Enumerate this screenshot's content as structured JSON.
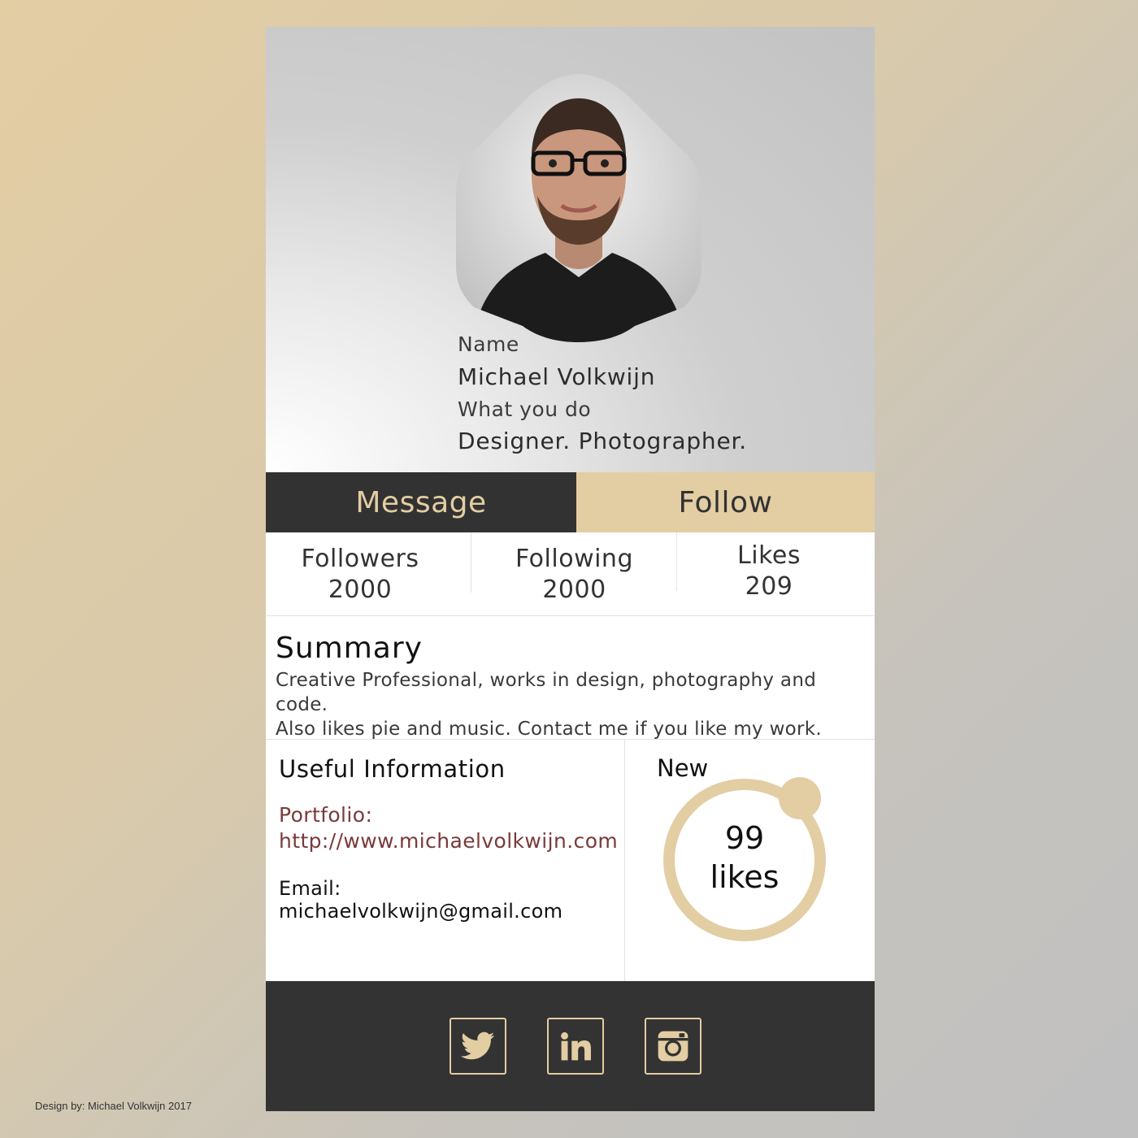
{
  "profile": {
    "name_label": "Name",
    "name": "Michael Volkwijn",
    "role_label": "What you do",
    "role": "Designer. Photographer."
  },
  "actions": {
    "message_label": "Message",
    "follow_label": "Follow"
  },
  "stats": [
    {
      "label": "Followers",
      "value": "2000"
    },
    {
      "label": "Following",
      "value": "2000"
    },
    {
      "label": "Likes",
      "value": "209"
    }
  ],
  "summary": {
    "title": "Summary",
    "line1": "Creative Professional, works in design, photography and code.",
    "line2": "Also likes pie and music. Contact me if you like my work."
  },
  "info": {
    "title": "Useful Information",
    "portfolio_label": "Portfolio:",
    "portfolio_url": "http://www.michaelvolkwijn.com",
    "email": "Email: michaelvolkwijn@gmail.com"
  },
  "new_likes": {
    "label": "New",
    "count": "99",
    "unit": "likes"
  },
  "social": [
    "twitter-icon",
    "linkedin-icon",
    "instagram-icon"
  ],
  "credit": "Design by: Michael Volkwijn 2017",
  "colors": {
    "accent": "#e3cda3",
    "dark": "#323232",
    "link": "#7a3a3a"
  }
}
